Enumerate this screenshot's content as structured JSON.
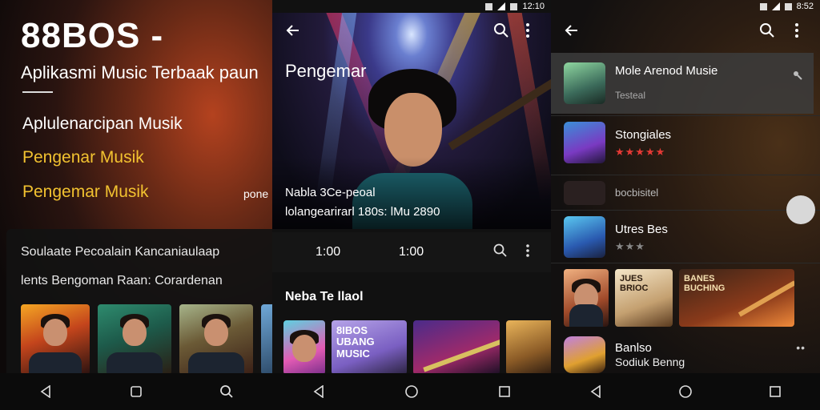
{
  "panel1": {
    "title": "88BOS -",
    "subtitle": "Aplikasmi Music Terbaak paun",
    "line_white": "Aplulenarcipan Musik",
    "line_gold_1": "Pengenar Musik",
    "line_gold_2": "Pengemar Musik",
    "side_text": "pone",
    "card": {
      "line_1": "Soulaate Pecoalain Kancaniaulaap",
      "line_2": "lents Bengoman Raan: Corardenan"
    },
    "thumbnails": [
      "album-1",
      "album-2",
      "album-3",
      "album-4"
    ],
    "nav": {
      "back": "back-triangle",
      "home": "home-square",
      "search": "search"
    }
  },
  "panel2": {
    "status_time": "12:10",
    "hero_title": "Pengemar",
    "hero_text_1": "Nabla 3Ce-peoal",
    "hero_text_2": "lolangearirarl 180s: lMu 2890",
    "control_value_1": "1:00",
    "control_value_2": "1:00",
    "section_title": "Neba Te llaol",
    "album_text": "8IBOS\nUBANG\nMUSIC",
    "nav": {
      "back": "back-triangle",
      "home": "home-circle",
      "recents": "recents-square"
    }
  },
  "panel3": {
    "status_time": "8:52",
    "rows": [
      {
        "name": "Mole Arenod Musie",
        "sub": "Testeal"
      },
      {
        "name": "Stongiales",
        "rating": "★★★★★"
      },
      {
        "name": "bocbisitel"
      },
      {
        "name": "Utres Bes",
        "rating": "★★★"
      },
      {
        "name": "Banlso",
        "sub": "Sodiuk Benng"
      }
    ],
    "album_text_1": "JUES\nBRIOC",
    "album_text_2": "BANES\nBUCHING",
    "colors": {
      "highlight_row": "#3c3c3c",
      "star_red": "#e53935",
      "star_grey": "#888888",
      "accent_gold": "#f2c230"
    },
    "nav": {
      "back": "back-triangle",
      "home": "home-circle",
      "recents": "recents-square"
    }
  }
}
